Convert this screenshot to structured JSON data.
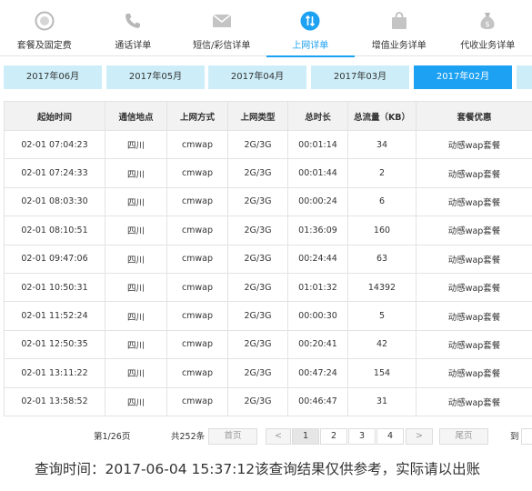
{
  "category_tabs": [
    {
      "label": "套餐及固定费",
      "icon": "clock-icon",
      "active": false
    },
    {
      "label": "通话详单",
      "icon": "phone-icon",
      "active": false
    },
    {
      "label": "短信/彩信详单",
      "icon": "envelope-icon",
      "active": false
    },
    {
      "label": "上网详单",
      "icon": "data-arrows-icon",
      "active": true
    },
    {
      "label": "增值业务详单",
      "icon": "shopping-bag-icon",
      "active": false
    },
    {
      "label": "代收业务详单",
      "icon": "money-bag-icon",
      "active": false
    }
  ],
  "month_tabs": [
    {
      "label": "2017年06月",
      "active": false
    },
    {
      "label": "2017年05月",
      "active": false
    },
    {
      "label": "2017年04月",
      "active": false
    },
    {
      "label": "2017年03月",
      "active": false
    },
    {
      "label": "2017年02月",
      "active": true
    }
  ],
  "table": {
    "headers": [
      "起始时间",
      "通信地点",
      "上网方式",
      "上网类型",
      "总时长",
      "总流量（KB）",
      "套餐优惠"
    ],
    "rows": [
      [
        "02-01 07:04:23",
        "四川",
        "cmwap",
        "2G/3G",
        "00:01:14",
        "34",
        "动感wap套餐"
      ],
      [
        "02-01 07:24:33",
        "四川",
        "cmwap",
        "2G/3G",
        "00:01:44",
        "2",
        "动感wap套餐"
      ],
      [
        "02-01 08:03:30",
        "四川",
        "cmwap",
        "2G/3G",
        "00:00:24",
        "6",
        "动感wap套餐"
      ],
      [
        "02-01 08:10:51",
        "四川",
        "cmwap",
        "2G/3G",
        "01:36:09",
        "160",
        "动感wap套餐"
      ],
      [
        "02-01 09:47:06",
        "四川",
        "cmwap",
        "2G/3G",
        "00:24:44",
        "63",
        "动感wap套餐"
      ],
      [
        "02-01 10:50:31",
        "四川",
        "cmwap",
        "2G/3G",
        "01:01:32",
        "14392",
        "动感wap套餐"
      ],
      [
        "02-01 11:52:24",
        "四川",
        "cmwap",
        "2G/3G",
        "00:00:30",
        "5",
        "动感wap套餐"
      ],
      [
        "02-01 12:50:35",
        "四川",
        "cmwap",
        "2G/3G",
        "00:20:41",
        "42",
        "动感wap套餐"
      ],
      [
        "02-01 13:11:22",
        "四川",
        "cmwap",
        "2G/3G",
        "00:47:24",
        "154",
        "动感wap套餐"
      ],
      [
        "02-01 13:58:52",
        "四川",
        "cmwap",
        "2G/3G",
        "00:46:47",
        "31",
        "动感wap套餐"
      ]
    ]
  },
  "pager": {
    "page_info": "第1/26页",
    "total": "共252条",
    "first": "首页",
    "prev": "<",
    "pages": [
      "1",
      "2",
      "3",
      "4"
    ],
    "current": "1",
    "next": ">",
    "last": "尾页",
    "goto": "到"
  },
  "footer": {
    "text": "查询时间：2017-06-04 15:37:12该查询结果仅供参考，实际请以出账"
  },
  "colors": {
    "accent": "#1da1f2",
    "month_tab_bg": "#cdeef9",
    "header_bg": "#f2f2f2",
    "border": "#e3e3e3",
    "icon_gray": "#b8b8b8"
  }
}
